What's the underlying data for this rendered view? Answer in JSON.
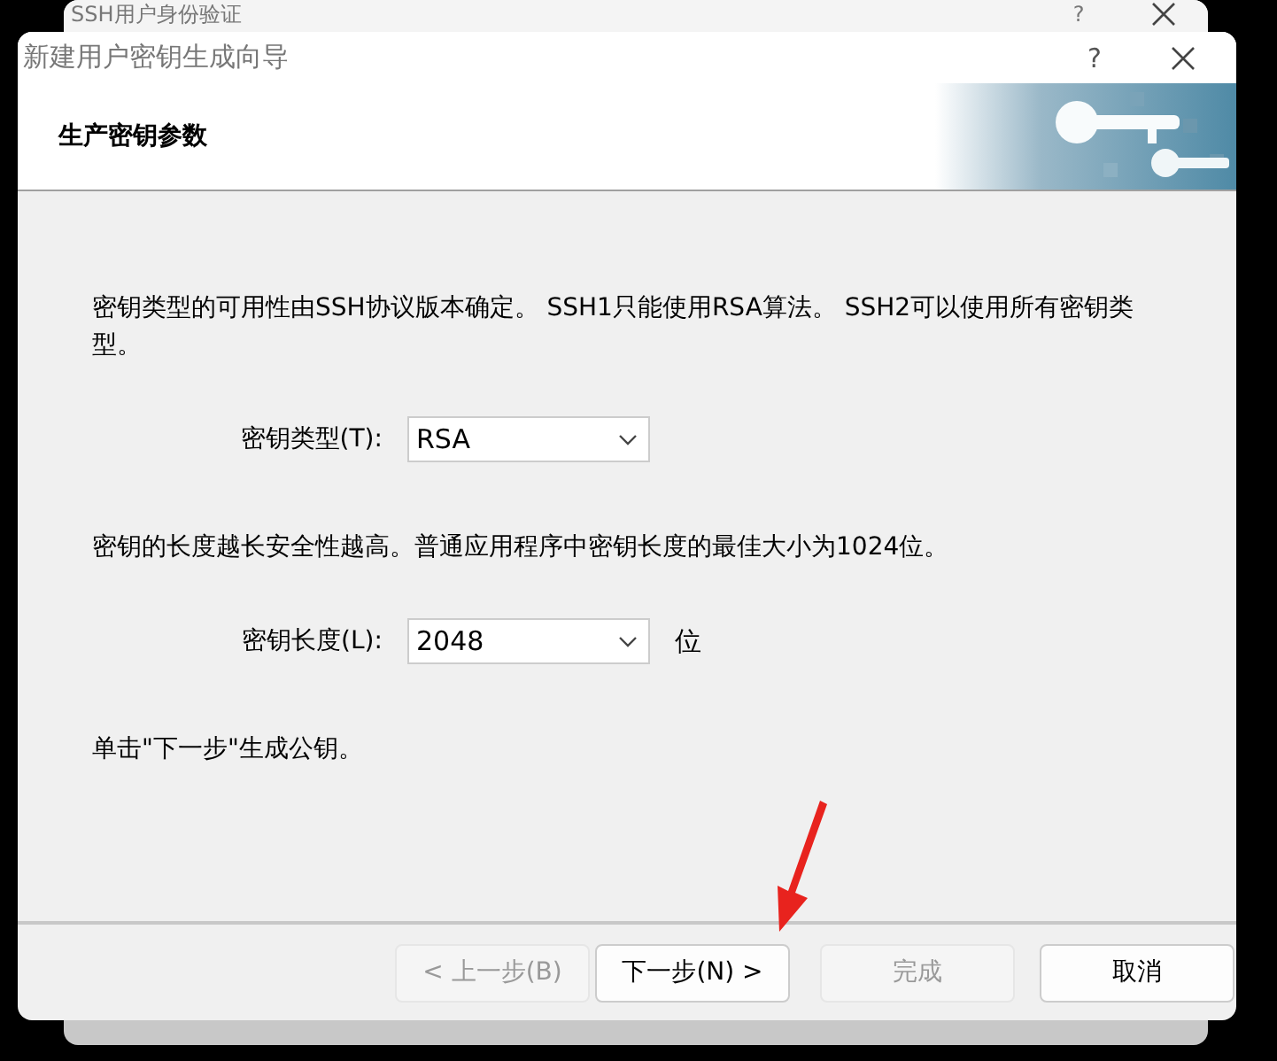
{
  "background_window": {
    "title": "SSH用户身份验证",
    "help": "?"
  },
  "window": {
    "title": "新建用户密钥生成向导",
    "help": "?"
  },
  "header": {
    "title": "生产密钥参数"
  },
  "body": [
    {
      "kind": "text",
      "text": "密钥类型的可用性由SSH协议版本确定。 SSH1只能使用RSA算法。 SSH2可以使用所有密钥类型。"
    },
    {
      "kind": "select",
      "label": "密钥类型(T):",
      "value": "RSA"
    },
    {
      "kind": "text",
      "text": "密钥的长度越长安全性越高。普通应用程序中密钥长度的最佳大小为1024位。"
    },
    {
      "kind": "select",
      "label": "密钥长度(L):",
      "value": "2048",
      "unit": "位"
    },
    {
      "kind": "text",
      "text": "单击\"下一步\"生成公钥。"
    }
  ],
  "buttons": [
    {
      "label": "< 上一步(B)",
      "disabled": true
    },
    {
      "label": "下一步(N) >",
      "disabled": false
    },
    {
      "label": "完成",
      "disabled": true
    },
    {
      "label": "取消",
      "disabled": false
    }
  ]
}
